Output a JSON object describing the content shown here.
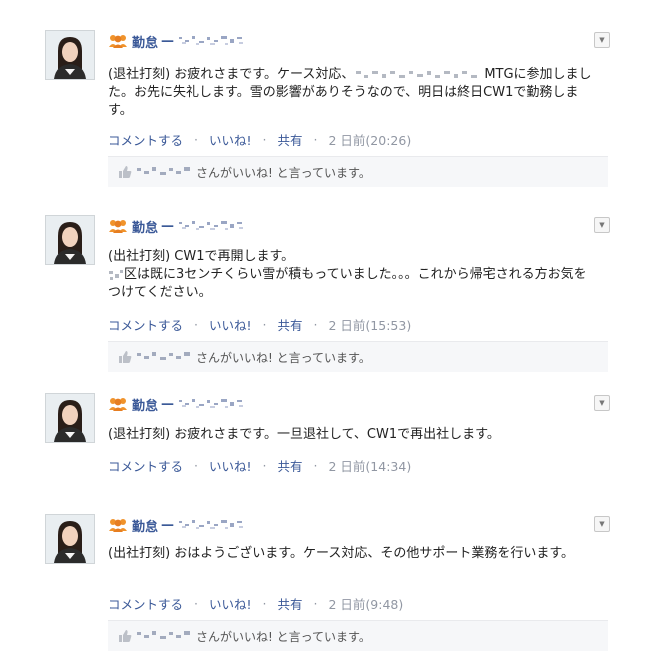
{
  "colors": {
    "link": "#3b5998",
    "meta": "#9197a3",
    "likes_bg": "#f6f7f9"
  },
  "posts": [
    {
      "author": "勤怠",
      "dash": "—",
      "text_parts": [
        "(退社打刻) お疲れさまです。ケース対応、",
        "MTGに参加しました。お先に失礼します。雪の影響がありそうなので、明日は終日CW1で勤務します。"
      ],
      "actions": {
        "comment": "コメントする",
        "like": "いいね!",
        "share": "共有",
        "sep": "·",
        "time": "2 日前(20:26)"
      },
      "likes": "さんがいいね! と言っています。"
    },
    {
      "author": "勤怠",
      "dash": "—",
      "text_line1": "(出社打刻) CW1で再開します。",
      "text_line2": "区は既に3センチくらい雪が積もっていました。。。これから帰宅される方お気をつけてください。",
      "actions": {
        "comment": "コメントする",
        "like": "いいね!",
        "share": "共有",
        "sep": "·",
        "time": "2 日前(15:53)"
      },
      "likes": "さんがいいね! と言っています。"
    },
    {
      "author": "勤怠",
      "dash": "—",
      "text": "(退社打刻) お疲れさまです。一旦退社して、CW1で再出社します。",
      "actions": {
        "comment": "コメントする",
        "like": "いいね!",
        "share": "共有",
        "sep": "·",
        "time": "2 日前(14:34)"
      }
    },
    {
      "author": "勤怠",
      "dash": "—",
      "text": "(出社打刻) おはようございます。ケース対応、その他サポート業務を行います。",
      "actions": {
        "comment": "コメントする",
        "like": "いいね!",
        "share": "共有",
        "sep": "·",
        "time": "2 日前(9:48)"
      },
      "likes": "さんがいいね! と言っています。"
    }
  ]
}
